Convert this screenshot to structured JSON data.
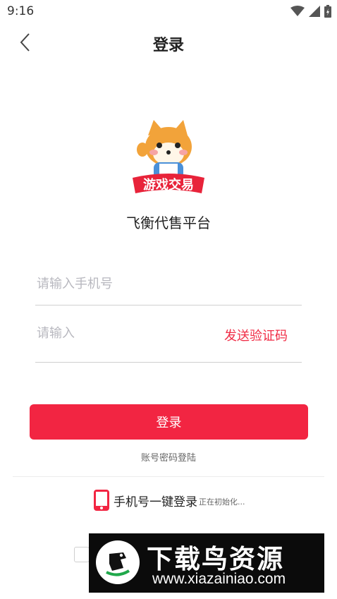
{
  "status_bar": {
    "time": "9:16"
  },
  "header": {
    "title": "登录"
  },
  "brand": {
    "logo_text": "游戏交易",
    "platform_name": "飞衡代售平台"
  },
  "form": {
    "phone_placeholder": "请输入手机号",
    "code_placeholder": "请输入",
    "send_code_label": "发送验证码",
    "login_button": "登录",
    "password_login": "账号密码登陆"
  },
  "one_click": {
    "label": "手机号一键登录",
    "status": "正在初始化..."
  },
  "watermark": {
    "title": "下载鸟资源",
    "url": "www.xiazainiao.com"
  },
  "colors": {
    "accent": "#f22542",
    "link": "#f02d46",
    "divider": "#cfcfcf"
  }
}
